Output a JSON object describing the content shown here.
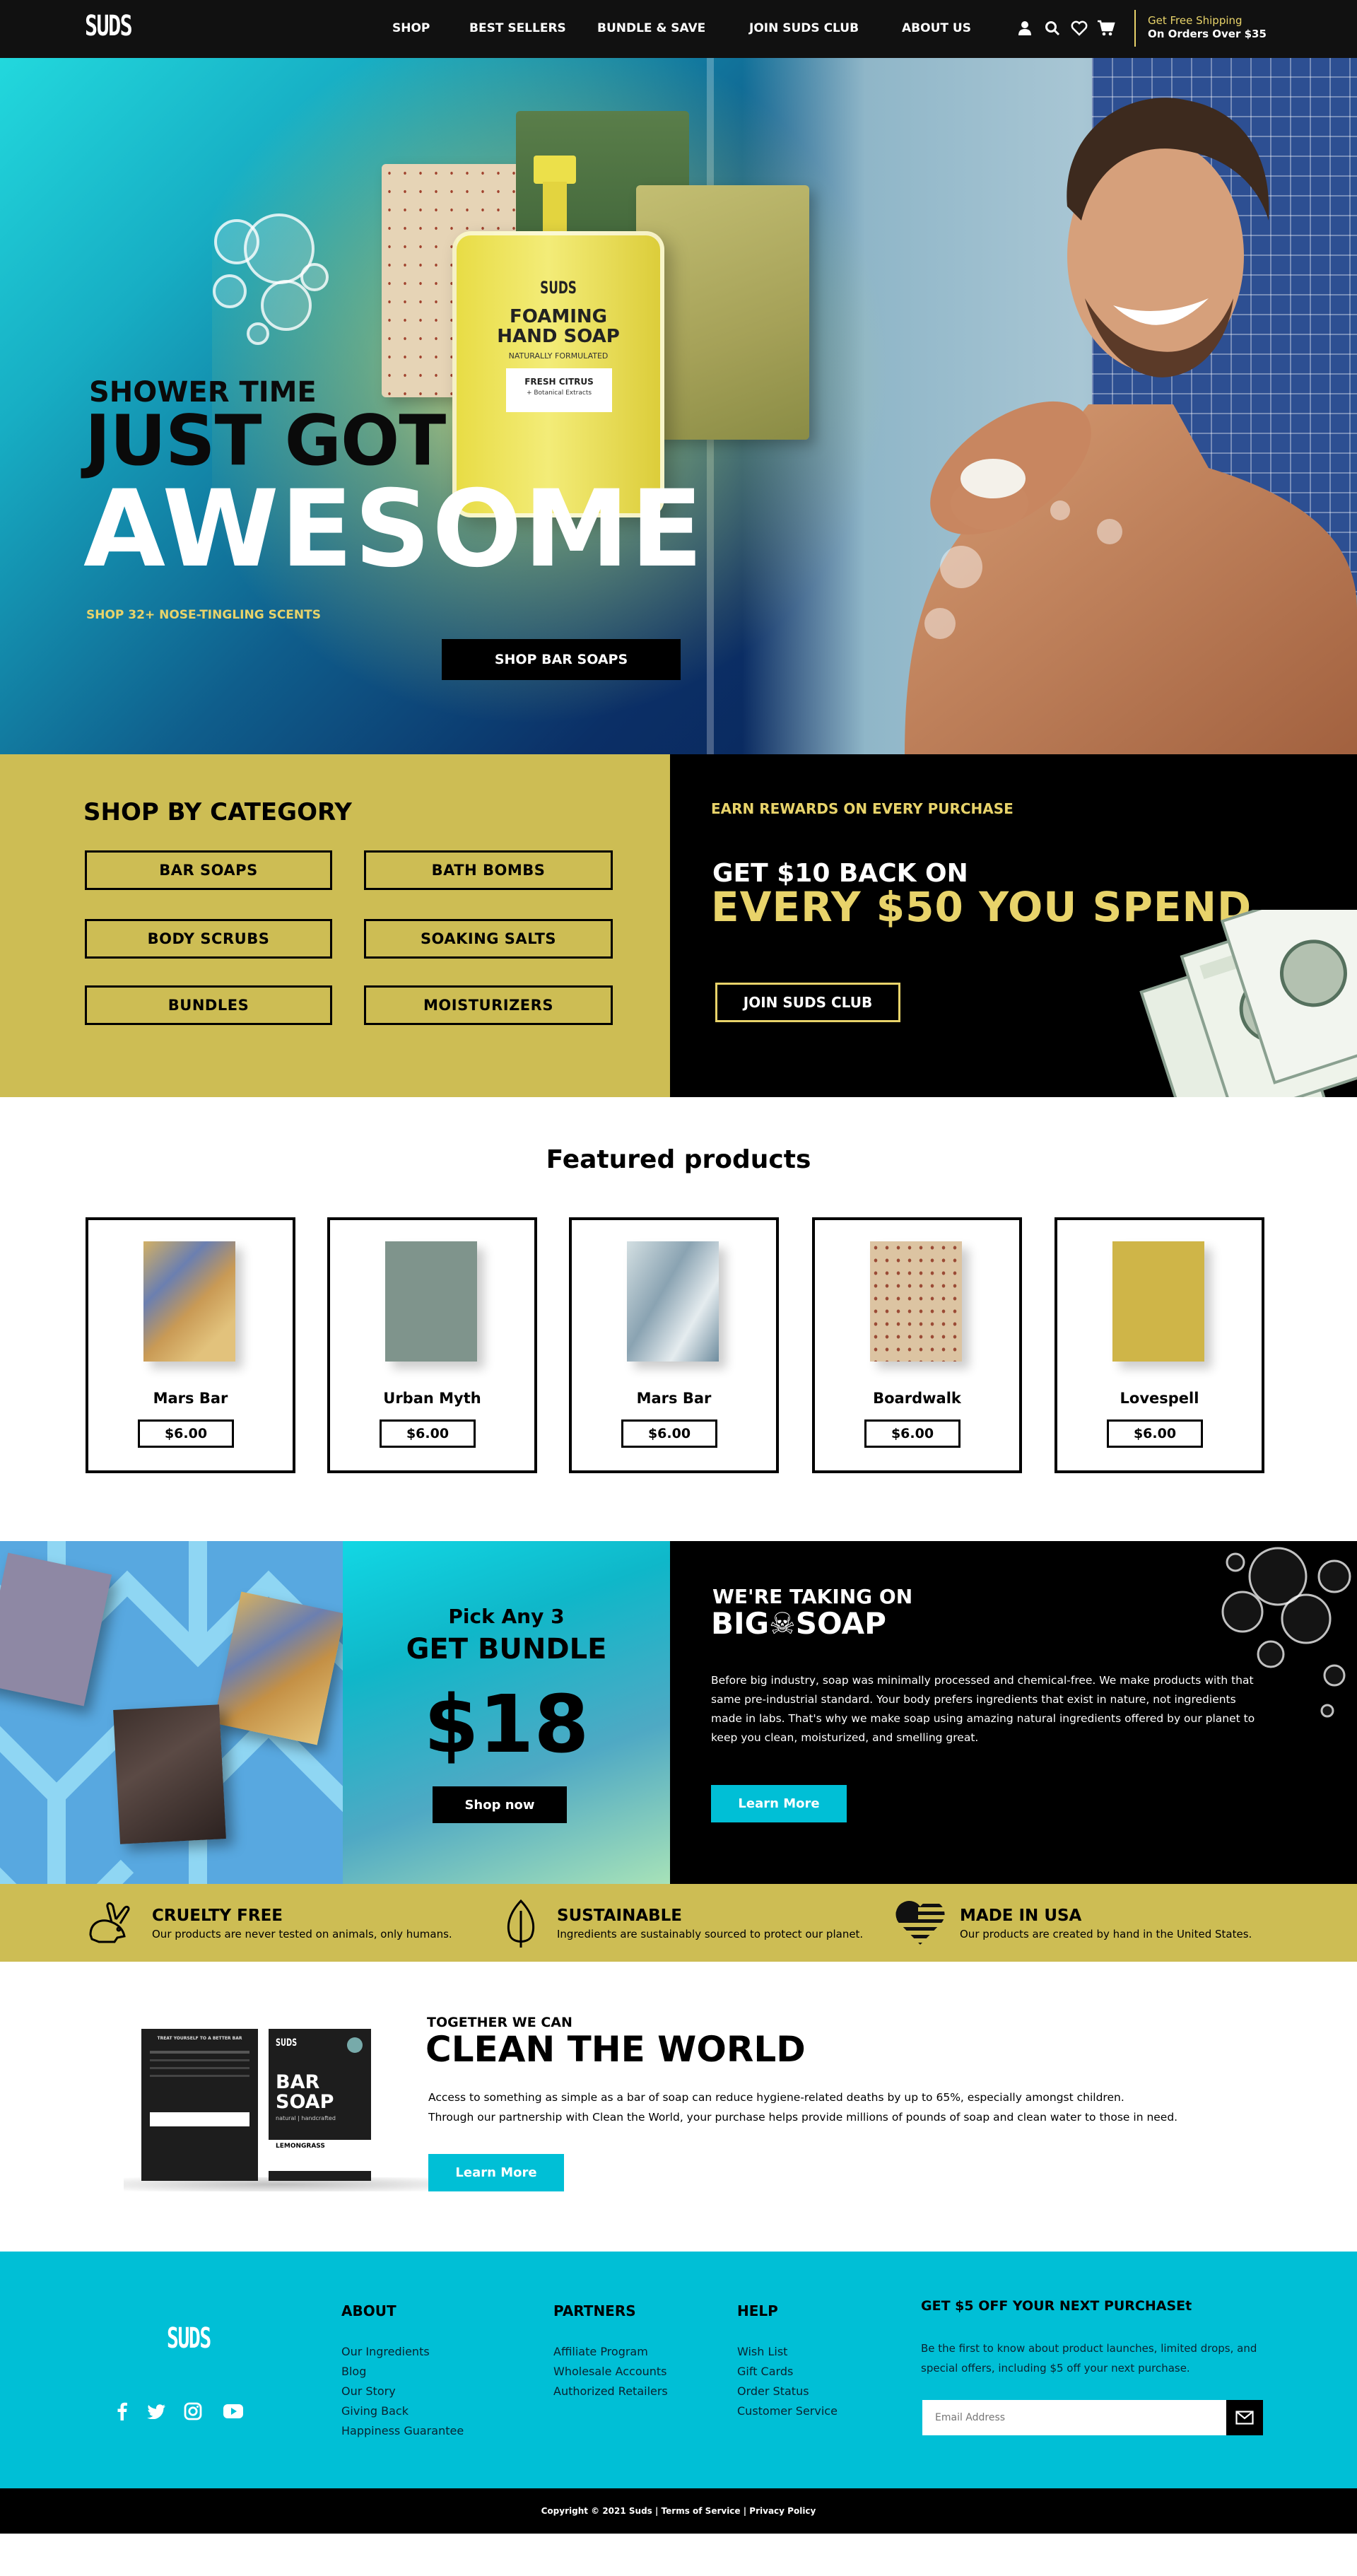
{
  "header": {
    "logo": "SUDS",
    "nav": [
      "SHOP",
      "BEST SELLERS",
      "BUNDLE & SAVE",
      "JOIN SUDS CLUB",
      "ABOUT US"
    ],
    "shipping_line1": "Get Free Shipping",
    "shipping_line2": "On Orders Over $35"
  },
  "hero": {
    "kicker": "SHOWER TIME",
    "line1": "JUST GOT",
    "line2": "AWESOME",
    "sub": "SHOP 32+ NOSE-TINGLING SCENTS",
    "cta": "SHOP BAR SOAPS",
    "bottle": {
      "brand": "SUDS",
      "title1": "FOAMING",
      "title2": "HAND SOAP",
      "tagline": "NATURALLY FORMULATED",
      "scent": "FRESH CITRUS",
      "scent_sub": "+ Botanical Extracts"
    }
  },
  "category": {
    "title": "SHOP BY CATEGORY",
    "items": [
      "BAR SOAPS",
      "BATH BOMBS",
      "BODY SCRUBS",
      "SOAKING SALTS",
      "BUNDLES",
      "MOISTURIZERS"
    ]
  },
  "rewards": {
    "kicker": "EARN REWARDS ON EVERY PURCHASE",
    "line1": "GET $10 BACK ON",
    "line2": "EVERY $50 YOU SPEND",
    "cta": "JOIN SUDS CLUB"
  },
  "featured": {
    "title": "Featured products",
    "products": [
      {
        "name": "Mars Bar",
        "price": "$6.00"
      },
      {
        "name": "Urban Myth",
        "price": "$6.00"
      },
      {
        "name": "Mars Bar",
        "price": "$6.00"
      },
      {
        "name": "Boardwalk",
        "price": "$6.00"
      },
      {
        "name": "Lovespell",
        "price": "$6.00"
      }
    ]
  },
  "bundle": {
    "kicker": "Pick Any 3",
    "title": "GET BUNDLE",
    "price": "$18",
    "cta": "Shop now"
  },
  "bigsoap": {
    "kicker": "WE'RE TAKING ON",
    "title": "BIG☠SOAP",
    "body": "Before big industry, soap was minimally processed and chemical-free. We make products with that same pre-industrial standard. Your body prefers ingredients that exist in nature, not ingredients made in labs. That's why we make soap using amazing natural ingredients offered by our planet to keep you clean, moisturized, and smelling great.",
    "cta": "Learn More"
  },
  "values": [
    {
      "icon": "rabbit-icon",
      "title": "CRUELTY FREE",
      "desc": "Our products are never tested on animals, only humans."
    },
    {
      "icon": "leaf-icon",
      "title": "SUSTAINABLE",
      "desc": "Ingredients are sustainably sourced to protect our planet."
    },
    {
      "icon": "usa-flag-heart-icon",
      "title": "MADE IN USA",
      "desc": "Our products are created by hand in the United States."
    }
  ],
  "clean": {
    "kicker": "TOGETHER WE CAN",
    "title": "CLEAN THE WORLD",
    "p1": "Access to something as simple as a bar of soap can reduce hygiene-related deaths by up to 65%, especially amongst children.",
    "p2": "Through our partnership with Clean the World, your purchase helps provide millions of pounds of soap and clean water to those in need.",
    "cta": "Learn More",
    "box": {
      "brand": "SUDS",
      "line1": "BAR",
      "line2": "SOAP",
      "sub": "natural | handcrafted",
      "scent": "LEMONGRASS",
      "dark_head": "TREAT YOURSELF TO A BETTER BAR"
    }
  },
  "footer": {
    "logo": "SUDS",
    "about": {
      "title": "ABOUT",
      "links": [
        "Our Ingredients",
        "Blog",
        "Our Story",
        "Giving Back",
        "Happiness Guarantee"
      ]
    },
    "partners": {
      "title": "PARTNERS",
      "links": [
        "Affiliate Program",
        "Wholesale Accounts",
        "Authorized Retailers"
      ]
    },
    "help": {
      "title": "HELP",
      "links": [
        "Wish List",
        "Gift Cards",
        "Order Status",
        "Customer Service"
      ]
    },
    "newsletter": {
      "title": "GET $5 OFF YOUR NEXT PURCHASEt",
      "text": "Be the first to know about product launches, limited drops, and special offers, including $5 off your next purchase.",
      "placeholder": "Email Address"
    },
    "social": [
      "facebook-icon",
      "twitter-icon",
      "instagram-icon",
      "youtube-icon"
    ],
    "copyright": "Copyright © 2021 Suds | Terms of Service | Privacy Policy"
  },
  "colors": {
    "accent_yellow": "#cdbd54",
    "cyan": "#00bfd6",
    "black": "#000000",
    "gold_text": "#e8d36a"
  }
}
